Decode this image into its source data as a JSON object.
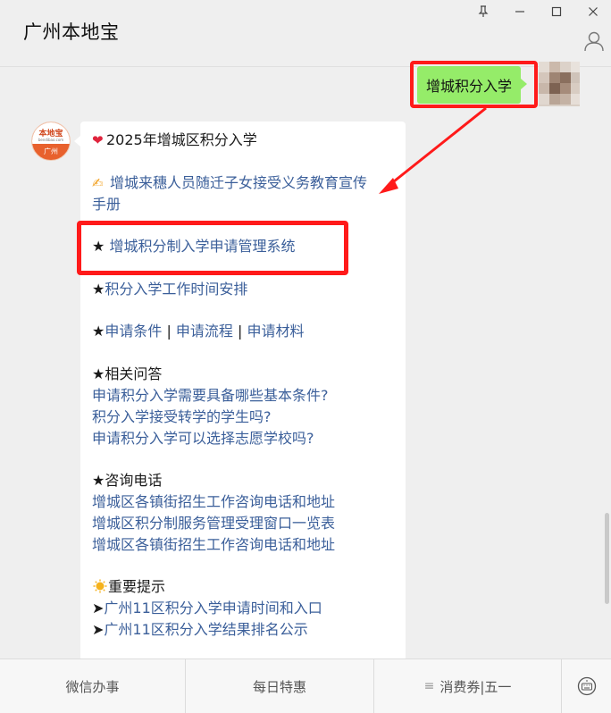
{
  "window": {
    "pin_glyph": "⊥",
    "minimize_glyph": "—",
    "maximize_glyph": "□",
    "close_glyph": "✕"
  },
  "header": {
    "title": "广州本地宝"
  },
  "outgoing": {
    "text": "增城积分入学"
  },
  "bot_avatar": {
    "brand": "本地宝",
    "tiny": "bendibao.com",
    "city": "广州"
  },
  "message": {
    "heading_emoji": "❤",
    "heading": "2025年增城区积分入学",
    "manual_emoji": "✍",
    "manual_line1": "增城来穗人员随迁子女接受义务教育宣传",
    "manual_line2": "手册",
    "system_star": "★ ",
    "system_link": "增城积分制入学申请管理系统",
    "schedule_star": "★",
    "schedule_link": "积分入学工作时间安排",
    "apply_star": "★",
    "apply_conditions": "申请条件",
    "sep1": " | ",
    "apply_process": "申请流程",
    "sep2": "  | ",
    "apply_materials": "申请材料",
    "faq_heading": "★相关问答",
    "faq_1": "申请积分入学需要具备哪些基本条件?",
    "faq_2": "积分入学接受转学的学生吗?",
    "faq_3": "申请积分入学可以选择志愿学校吗?",
    "phone_heading": "★咨询电话",
    "phone_1": "增城区各镇街招生工作咨询电话和地址",
    "phone_2": "增城区积分制服务管理受理窗口一览表",
    "phone_3": "增城区各镇街招生工作咨询电话和地址",
    "notice_heading": "重要提示",
    "arrow_glyph": "➤",
    "notice_1": "广州11区积分入学申请时间和入口",
    "notice_2": "广州11区积分入学结果排名公示"
  },
  "bottom_menu": {
    "tab1": "微信办事",
    "tab2": "每日特惠",
    "tab3_glyph": "≡",
    "tab3": "消费券|五一"
  },
  "colors": {
    "accent_red": "#ff1a1a",
    "link_blue": "#3b5f9a",
    "bubble_green": "#95ec69",
    "background": "#efefef"
  },
  "icons": [
    "pin-icon",
    "minimize-icon",
    "maximize-icon",
    "close-icon",
    "profile-icon",
    "heart-icon",
    "writing-hand-icon",
    "sun-icon",
    "keyboard-icon",
    "menu-icon"
  ]
}
